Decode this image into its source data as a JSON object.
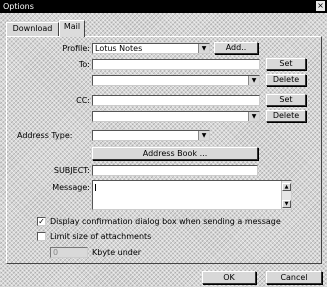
{
  "window": {
    "title": "Options",
    "close_glyph": "×"
  },
  "tabs": [
    {
      "label": "Download",
      "active": false
    },
    {
      "label": "Mail",
      "active": true
    }
  ],
  "form": {
    "profile": {
      "label": "Profile:",
      "value": "Lotus Notes",
      "button": "Add.."
    },
    "to": {
      "label": "To:",
      "value": "",
      "set_button": "Set",
      "delete_button": "Delete",
      "list_value": ""
    },
    "cc": {
      "label": "CC:",
      "value": "",
      "set_button": "Set",
      "delete_button": "Delete",
      "list_value": ""
    },
    "address_type": {
      "label": "Address Type:",
      "value": ""
    },
    "address_book_button": "Address Book ...",
    "subject": {
      "label": "SUBJECT:",
      "value": ""
    },
    "message": {
      "label": "Message:",
      "value": ""
    },
    "confirm_checkbox": {
      "label": "Display confirmation dialog box when sending a message",
      "checked": true
    },
    "limit_checkbox": {
      "label": "Limit size of attachments",
      "checked": false
    },
    "kbyte": {
      "value": "0",
      "unit": "Kbyte under"
    }
  },
  "footer": {
    "ok": "OK",
    "cancel": "Cancel"
  },
  "icons": {
    "check": "✓",
    "dropdown": "▼",
    "scroll_up": "▲",
    "scroll_down": "▼"
  }
}
